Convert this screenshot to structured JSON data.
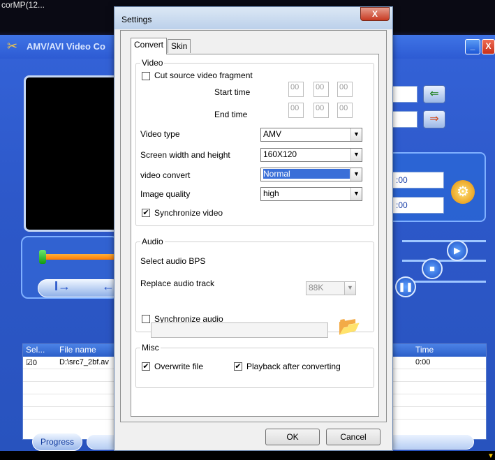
{
  "taskbar": {
    "title": "corMP(12..."
  },
  "app": {
    "title": "AMV/AVI Video Co",
    "minimize": "_",
    "close": "X"
  },
  "time_fields": {
    "start": ":00",
    "end": ":00"
  },
  "nav": {
    "mark_in": "I→",
    "mark_out": "←"
  },
  "file_table": {
    "headers": {
      "sel": "Sel...",
      "file_name": "File name",
      "time": "Time"
    },
    "rows": [
      {
        "sel": "☑0",
        "file": "D:\\src7_2bf.av",
        "time": "0:00"
      }
    ]
  },
  "progress": {
    "label": "Progress"
  },
  "dialog": {
    "title": "Settings",
    "close": "X",
    "tabs": {
      "convert": "Convert",
      "skin": "Skin"
    },
    "video": {
      "group": "Video",
      "cut_source": "Cut source video fragment",
      "start_time": "Start time",
      "end_time": "End time",
      "time_values": {
        "h": "00",
        "m": "00",
        "s": "00"
      },
      "video_type_label": "Video type",
      "video_type_value": "AMV",
      "screen_label": "Screen width and height",
      "screen_value": "160X120",
      "convert_label": "video convert",
      "convert_value": "Normal",
      "quality_label": "Image quality",
      "quality_value": "high",
      "sync_video": "Synchronize video",
      "sync_video_checked": "✔"
    },
    "audio": {
      "group": "Audio",
      "bps_label": "Select audio BPS",
      "bps_value": "88K",
      "replace_label": "Replace audio track",
      "sync_audio": "Synchronize audio"
    },
    "misc": {
      "group": "Misc",
      "overwrite": "Overwrite file",
      "overwrite_checked": "✔",
      "playback": "Playback after converting",
      "playback_checked": "✔"
    },
    "ok": "OK",
    "cancel": "Cancel"
  }
}
